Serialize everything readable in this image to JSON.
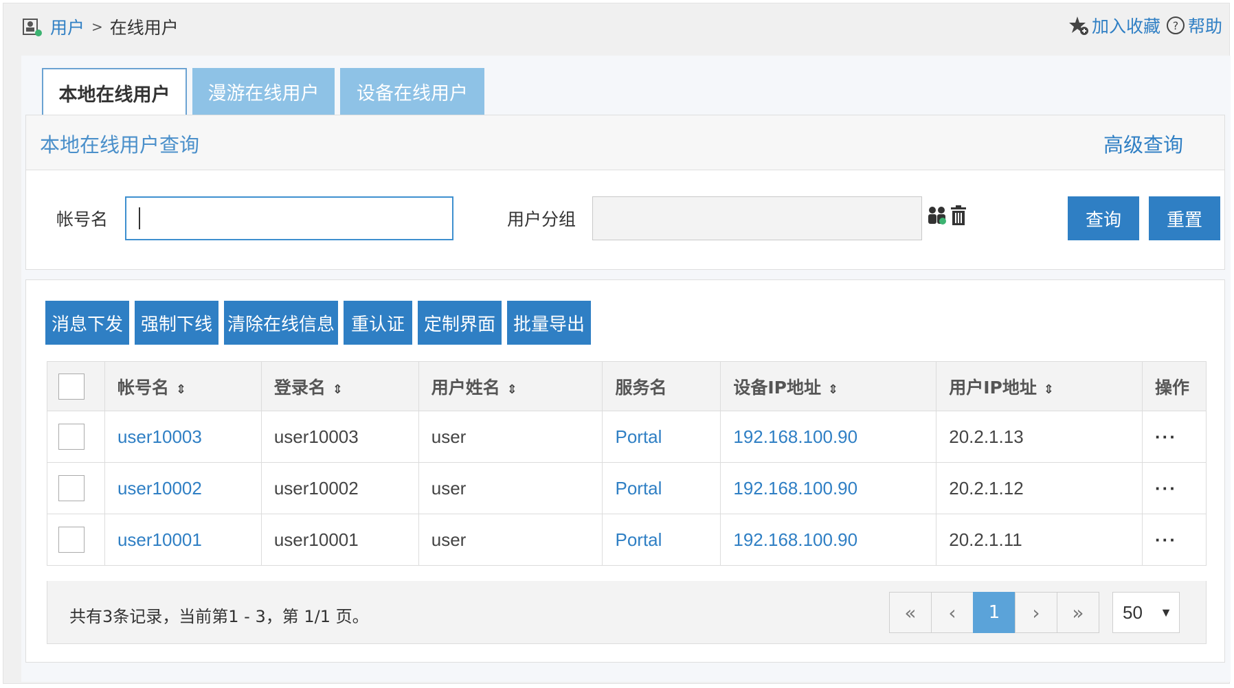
{
  "breadcrumb": {
    "parent": "用户",
    "separator": ">",
    "current": "在线用户"
  },
  "top_actions": {
    "favorite": "加入收藏",
    "help": "帮助"
  },
  "tabs": [
    {
      "label": "本地在线用户",
      "active": true
    },
    {
      "label": "漫游在线用户",
      "active": false
    },
    {
      "label": "设备在线用户",
      "active": false
    }
  ],
  "query": {
    "title": "本地在线用户查询",
    "advanced": "高级查询",
    "account_label": "帐号名",
    "account_value": "",
    "group_label": "用户分组",
    "group_value": "",
    "search_button": "查询",
    "reset_button": "重置"
  },
  "actions": [
    "消息下发",
    "强制下线",
    "清除在线信息",
    "重认证",
    "定制界面",
    "批量导出"
  ],
  "table": {
    "columns": [
      "帐号名",
      "登录名",
      "用户姓名",
      "服务名",
      "设备IP地址",
      "用户IP地址",
      "操作"
    ],
    "rows": [
      {
        "account": "user10003",
        "login": "user10003",
        "name": "user",
        "service": "Portal",
        "device_ip": "192.168.100.90",
        "user_ip": "20.2.1.13",
        "op": "···"
      },
      {
        "account": "user10002",
        "login": "user10002",
        "name": "user",
        "service": "Portal",
        "device_ip": "192.168.100.90",
        "user_ip": "20.2.1.12",
        "op": "···"
      },
      {
        "account": "user10001",
        "login": "user10001",
        "name": "user",
        "service": "Portal",
        "device_ip": "192.168.100.90",
        "user_ip": "20.2.1.11",
        "op": "···"
      }
    ]
  },
  "footer": {
    "record_info": "共有3条记录，当前第1 - 3，第 1/1 页。",
    "pager": {
      "first": "«",
      "prev": "‹",
      "current": "1",
      "next": "›",
      "last": "»"
    },
    "page_size": "50",
    "page_size_arrow": "▼"
  },
  "colors": {
    "primary": "#2f7fc4",
    "tab_inactive": "#8ec2e6",
    "page_current": "#5ba3d9"
  }
}
